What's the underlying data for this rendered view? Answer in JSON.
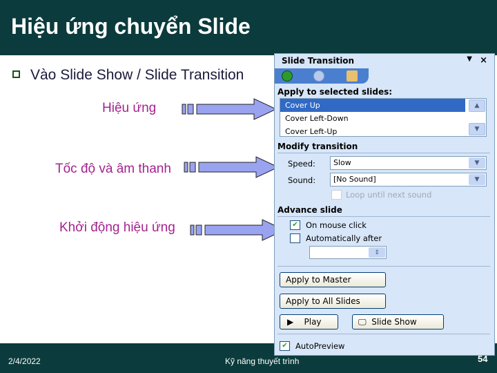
{
  "slide": {
    "title": "Hiệu ứng chuyển Slide",
    "bullet": "Vào Slide Show / Slide Transition",
    "labels": [
      "Hiệu ứng",
      "Tốc độ và âm thanh",
      "Khởi động hiệu ứng"
    ],
    "footer": {
      "date": "2/4/2022",
      "text": "Kỹ năng thuyết trình",
      "page": "54"
    },
    "colors": {
      "header": "#0b3b3c",
      "label": "#a3238e",
      "arrow": "#9aa3f0"
    }
  },
  "panel": {
    "title": "Slide Transition",
    "close": "×",
    "dropdown": "▼",
    "apply_heading": "Apply to selected slides:",
    "transitions": [
      "Cover Up",
      "Cover Left-Down",
      "Cover Left-Up"
    ],
    "selected": "Cover Up",
    "modify_heading": "Modify transition",
    "speed_label": "Speed:",
    "speed_value": "Slow",
    "sound_label": "Sound:",
    "sound_value": "[No Sound]",
    "loop_label": "Loop until next sound",
    "advance_heading": "Advance slide",
    "on_click_label": "On mouse click",
    "on_click_checked": true,
    "auto_label": "Automatically after",
    "auto_checked": false,
    "auto_value": "",
    "apply_master": "Apply to Master",
    "apply_all": "Apply to All Slides",
    "play": "Play",
    "slideshow": "Slide Show",
    "autopreview_label": "AutoPreview",
    "autopreview_checked": true
  }
}
